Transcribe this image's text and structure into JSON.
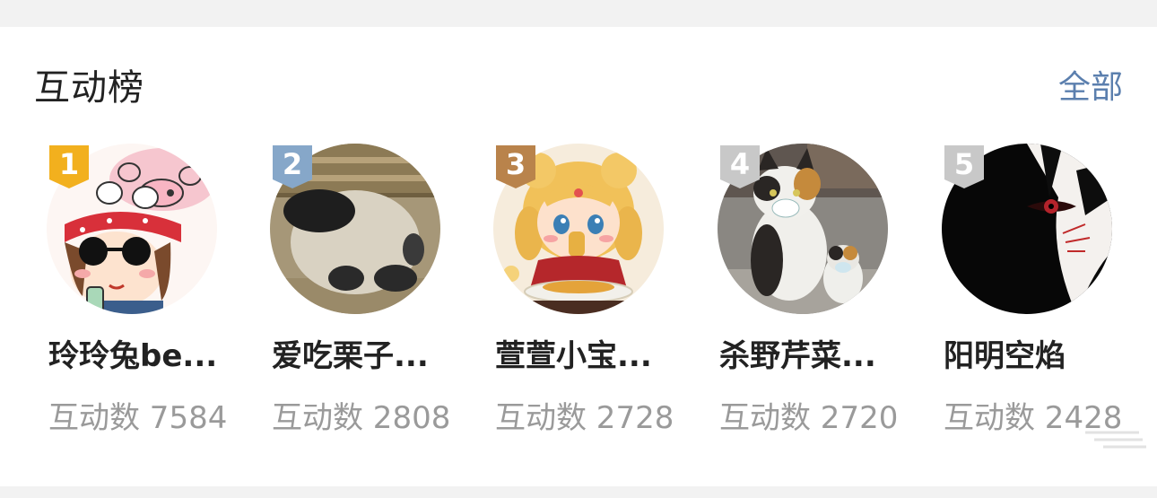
{
  "header": {
    "title": "互动榜",
    "all_link": "全部"
  },
  "users": [
    {
      "rank": "1",
      "name": "玲玲兔be...",
      "count": "互动数 7584",
      "badge_color": "#f2b01e",
      "avatar": "pig-cartoon-avatar"
    },
    {
      "rank": "2",
      "name": "爱吃栗子...",
      "count": "互动数 2808",
      "badge_color": "#86a7c9",
      "avatar": "panda-photo-avatar"
    },
    {
      "rank": "3",
      "name": "萱萱小宝...",
      "count": "互动数 2728",
      "badge_color": "#b9834b",
      "avatar": "anime-girl-avatar"
    },
    {
      "rank": "4",
      "name": "杀野芹菜...",
      "count": "互动数 2720",
      "badge_color": "#c8c8c8",
      "avatar": "cat-photo-avatar"
    },
    {
      "rank": "5",
      "name": "阳明空焰",
      "count": "互动数 2428",
      "badge_color": "#c8c8c8",
      "avatar": "dark-anime-avatar"
    }
  ]
}
